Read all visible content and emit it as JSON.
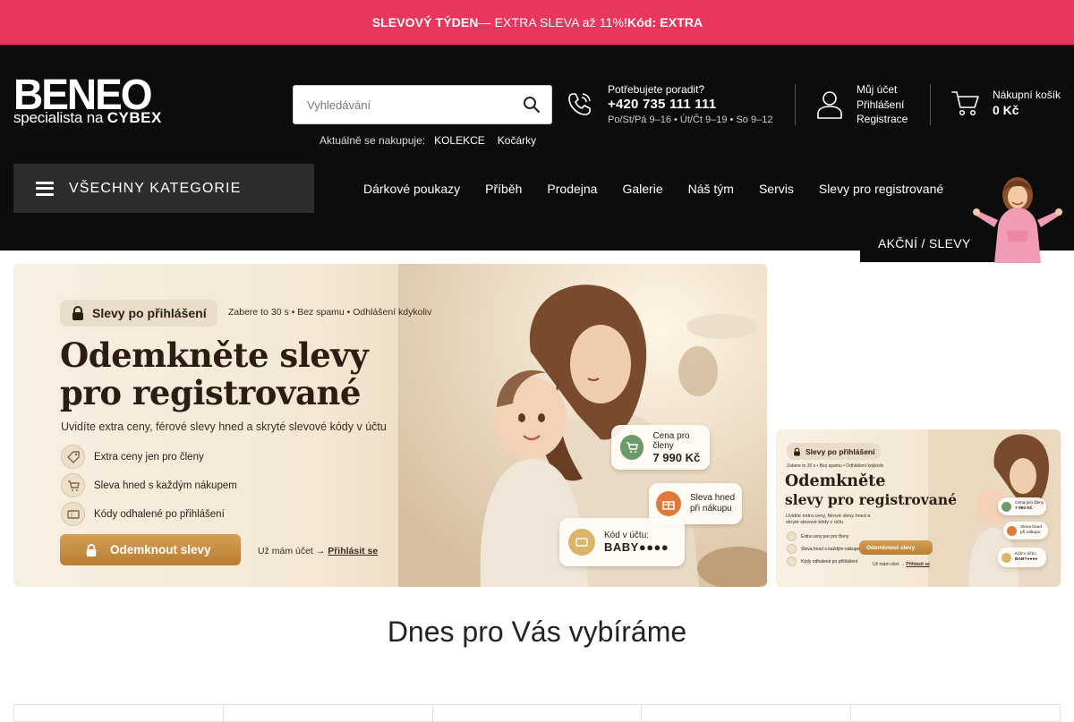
{
  "promo": {
    "glyph": "",
    "title": "SLEVOVÝ TÝDEN",
    "text": " — EXTRA SLEVA až 11%! ",
    "code": "Kód: EXTRA"
  },
  "header": {
    "logo": {
      "brand": "BENEO",
      "tagline_prefix": "specialista na ",
      "tagline_brand": "CYBEX"
    },
    "search": {
      "placeholder": "Vyhledávání"
    },
    "shopping_now": {
      "label": "Aktuálně se nakupuje:",
      "links": [
        "KOLEKCE",
        "Kočárky"
      ]
    },
    "contact": {
      "question": "Potřebujete poradit?",
      "phone": "+420 735 111 111",
      "hours": "Po/St/Pá 9–16 • Út/Čt 9–19 • So 9–12"
    },
    "account": {
      "title": "Můj účet",
      "login": "Přihlášení",
      "register": "Registrace"
    },
    "cart": {
      "title": "Nákupní košík",
      "total": "0 Kč"
    }
  },
  "nav": {
    "all_categories": "VŠECHNY KATEGORIE",
    "links": [
      "Dárkové poukazy",
      "Příběh",
      "Prodejna",
      "Galerie",
      "Náš tým",
      "Servis",
      "Slevy pro registrované"
    ],
    "sale": "AKČNÍ / SLEVY"
  },
  "banner": {
    "pill": "Slevy po přihlášení",
    "pill_note": "Zabere to 30 s • Bez spamu • Odhlášení kdykoliv",
    "title_line1": "Odemkněte slevy",
    "title_line2": "pro registrované",
    "subtitle": "Uvidíte extra ceny, férové slevy hned a skryté slevové kódy v účtu",
    "bullets": [
      "Extra ceny jen pro členy",
      "Sleva hned s každým nákupem",
      "Kódy odhalené po přihlášení"
    ],
    "cta": "Odemknout slevy",
    "login_prefix": "Už mám účet → ",
    "login_link": "Přihlásit se",
    "card_price_label": "Cena pro členy",
    "card_price": "7 990 Kč",
    "card_discount_l1": "Sleva hned",
    "card_discount_l2": "při nákupu",
    "card_code_label": "Kód v účtu:",
    "card_code": "BABY●●●●"
  },
  "banner_side": {
    "pill": "Slevy po přihlášení",
    "pill_note": "Zabere to 30 s • Bez spamu • Odhlášení kdykoliv",
    "title_line1": "Odemkněte",
    "title_line2": "slevy pro registrované",
    "subtitle": "Uvidíte extra ceny, férové slevy hned a skryté slevové kódy v účtu",
    "bullets": [
      "Extra ceny jen pro členy",
      "Sleva hned s každým nákupem",
      "Kódy odhalené po přihlášení"
    ],
    "cta": "Odemknout slevy",
    "login_prefix": "Už mám účet → ",
    "login_link": "Přihlásit se",
    "card_price_label": "Cena pro členy",
    "card_price": "7 990 Kč",
    "card_discount_l1": "Sleva hned",
    "card_discount_l2": "při nákupu",
    "card_code_label": "Kód v účtu:",
    "card_code": "BABY●●●●"
  },
  "section": {
    "title": "Dnes pro Vás vybíráme"
  },
  "icons": {
    "promo": "glyph",
    "search": "search-icon",
    "phone": "phone-icon",
    "account": "user-icon",
    "cart": "cart-icon",
    "menu": "hamburger-icon",
    "lock": "lock-icon",
    "tag": "tag-icon",
    "bullet_cart": "cart-icon",
    "ticket": "ticket-icon",
    "gift": "gift-icon"
  },
  "colors": {
    "promo_bg": "#e8365d",
    "header_bg": "#0c0c0c",
    "allcat_bg": "#2d2d2d",
    "cta_gold": "#c88d44",
    "card_green": "#6d9a6a",
    "card_orange": "#e07a3c"
  }
}
